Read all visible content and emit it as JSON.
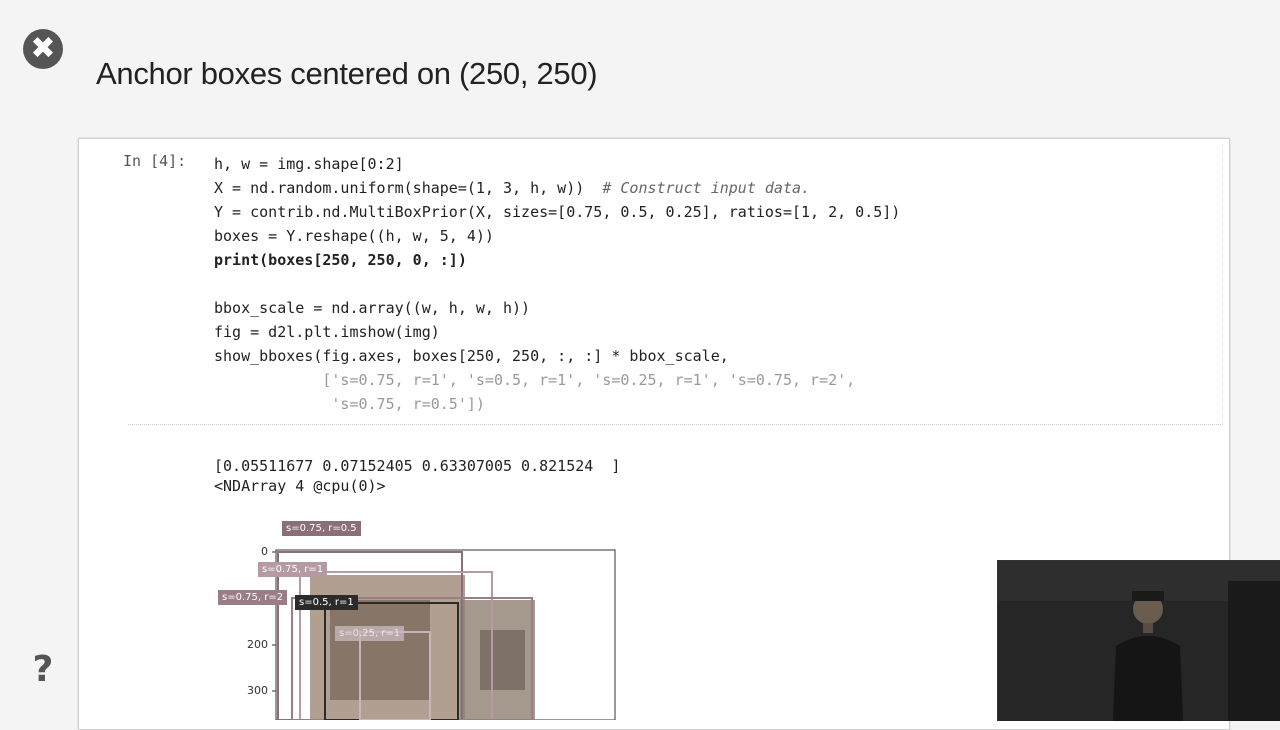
{
  "slide": {
    "title": "Anchor boxes centered on (250, 250)",
    "close_glyph": "✖",
    "help_glyph": "?"
  },
  "cell": {
    "prompt": "In [4]:",
    "code_lines": [
      "h, w = img.shape[0:2]",
      "X = nd.random.uniform(shape=(1, 3, h, w))  ",
      "Y = contrib.nd.MultiBoxPrior(X, sizes=[0.75, 0.5, 0.25], ratios=[1, 2, 0.5])",
      "boxes = Y.reshape((h, w, 5, 4))",
      "print(boxes[250, 250, 0, :])",
      "",
      "bbox_scale = nd.array((w, h, w, h))",
      "fig = d2l.plt.imshow(img)",
      "show_bboxes(fig.axes, boxes[250, 250, :, :] * bbox_scale,",
      "            ['s=0.75, r=1', 's=0.5, r=1', 's=0.25, r=1', 's=0.75, r=2',",
      "             's=0.75, r=0.5'])"
    ],
    "comment": "# Construct input data."
  },
  "output": {
    "line1": "[0.05511677 0.07152405 0.63307005 0.821524  ]",
    "line2": "<NDArray 4 @cpu(0)>"
  },
  "plot": {
    "yticks": [
      "0",
      "200",
      "300"
    ],
    "labels": [
      {
        "text": "s=0.75, r=0.5",
        "color": "#8a6f78"
      },
      {
        "text": "s=0.75, r=1",
        "color": "#b59aa4"
      },
      {
        "text": "s=0.75, r=2",
        "color": "#9b7d87"
      },
      {
        "text": "s=0.5, r=1",
        "color": "#2b2b2b"
      },
      {
        "text": "s=0.25, r=1",
        "color": "#c8b5bb"
      }
    ]
  },
  "colors": {
    "background": "#f4f4f4",
    "close_button": "#555555"
  }
}
